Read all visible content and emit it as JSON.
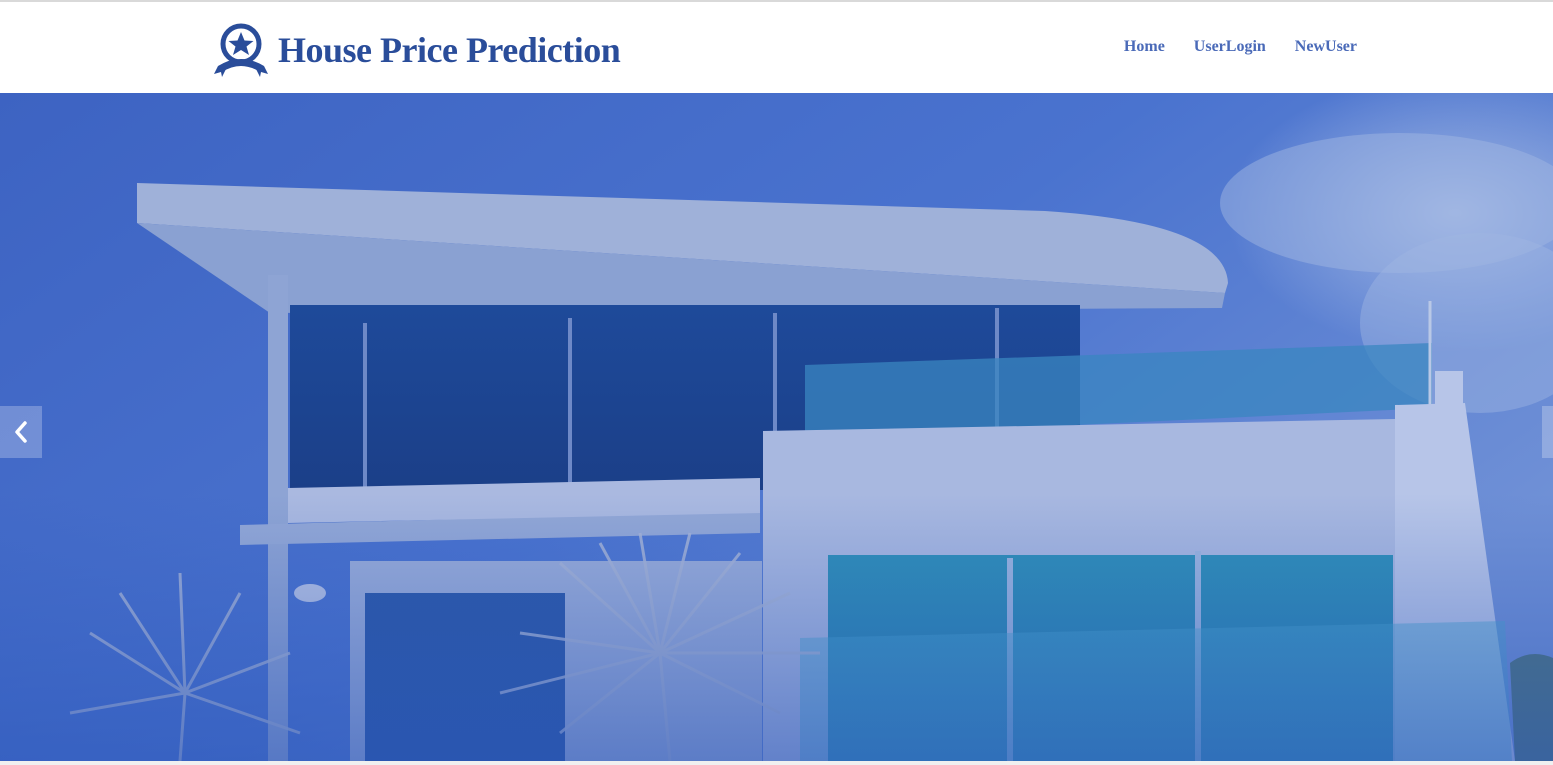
{
  "brand": {
    "title": "House Price Prediction",
    "icon": "star-badge-icon",
    "color": "#2a4d9a"
  },
  "nav": {
    "items": [
      {
        "label": "Home"
      },
      {
        "label": "UserLogin"
      },
      {
        "label": "NewUser"
      }
    ],
    "color": "#4a6ab8"
  },
  "hero": {
    "image": "modern-house-photo",
    "overlay_color": "#3a64c8",
    "controls": {
      "prev_icon": "chevron-left-icon",
      "next_icon": "chevron-right-icon"
    }
  }
}
